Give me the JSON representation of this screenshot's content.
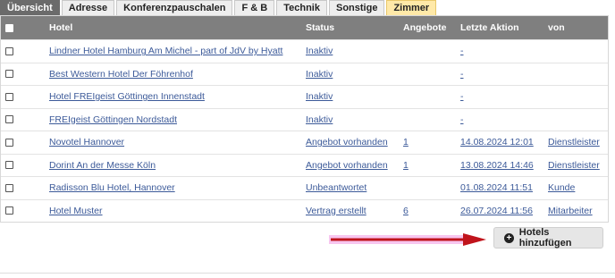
{
  "tabs": [
    "Übersicht",
    "Adresse",
    "Konferenzpauschalen",
    "F & B",
    "Technik",
    "Sonstige",
    "Zimmer"
  ],
  "table": {
    "headers": {
      "hotel": "Hotel",
      "status": "Status",
      "angebote": "Angebote",
      "aktion": "Letzte Aktion",
      "von": "von"
    },
    "rows": [
      {
        "hotel": "Lindner Hotel Hamburg Am Michel - part of JdV by Hyatt",
        "status": "Inaktiv",
        "angebote": "",
        "aktion": "-",
        "von": ""
      },
      {
        "hotel": "Best Western Hotel Der Föhrenhof",
        "status": "Inaktiv",
        "angebote": "",
        "aktion": "-",
        "von": ""
      },
      {
        "hotel": "Hotel FREIgeist Göttingen Innenstadt",
        "status": "Inaktiv",
        "angebote": "",
        "aktion": "-",
        "von": ""
      },
      {
        "hotel": "FREIgeist Göttingen Nordstadt",
        "status": "Inaktiv",
        "angebote": "",
        "aktion": "-",
        "von": ""
      },
      {
        "hotel": "Novotel Hannover",
        "status": "Angebot vorhanden",
        "angebote": "1",
        "aktion": "14.08.2024 12:01",
        "von": "Dienstleister"
      },
      {
        "hotel": "Dorint An der Messe Köln",
        "status": "Angebot vorhanden",
        "angebote": "1",
        "aktion": "13.08.2024 14:46",
        "von": "Dienstleister"
      },
      {
        "hotel": "Radisson Blu Hotel, Hannover",
        "status": "Unbeantwortet",
        "angebote": "",
        "aktion": "01.08.2024 11:51",
        "von": "Kunde"
      },
      {
        "hotel": "Hotel Muster",
        "status": "Vertrag erstellt",
        "angebote": "6",
        "aktion": "26.07.2024 11:56",
        "von": "Mitarbeiter"
      }
    ]
  },
  "add_button": {
    "label": "Hotels hinzufügen",
    "icon": "plus-circle-icon"
  },
  "colors": {
    "header_bg": "#7f7f7f",
    "active_tab": "#6b6b6b",
    "highlight_tab": "#ffe9a8",
    "link": "#3c5a99",
    "arrow": "#c0141c"
  }
}
